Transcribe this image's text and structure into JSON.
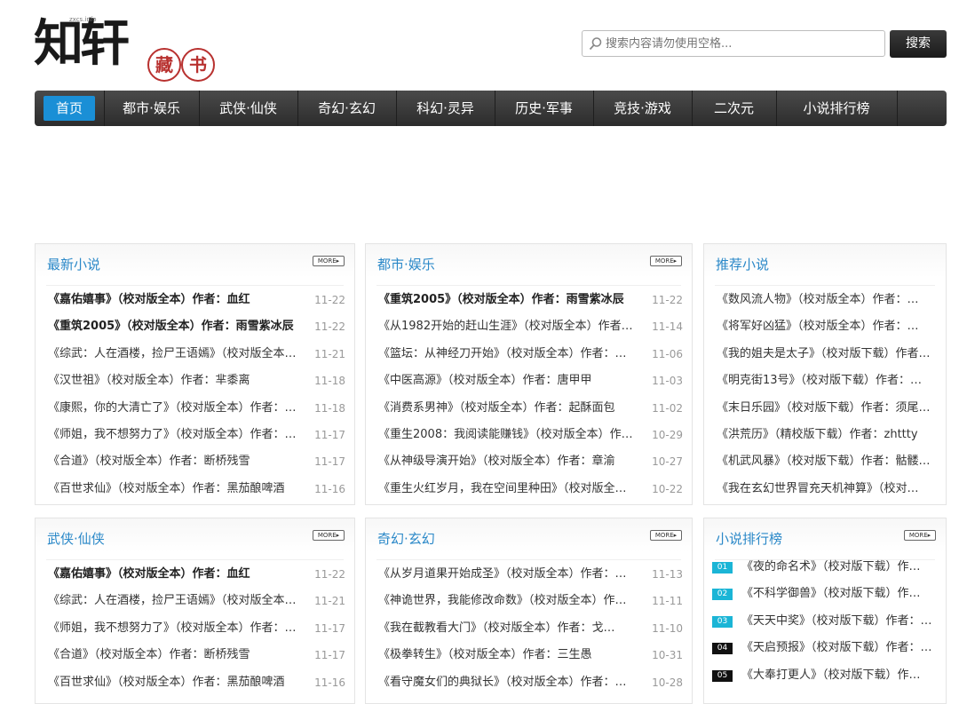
{
  "logo": {
    "main": "知轩",
    "small": "zxcs.info",
    "seal1": "藏",
    "seal2": "书"
  },
  "search": {
    "placeholder": "搜索内容请勿使用空格...",
    "button": "搜索"
  },
  "nav": [
    "首页",
    "都市·娱乐",
    "武侠·仙侠",
    "奇幻·玄幻",
    "科幻·灵异",
    "历史·军事",
    "竞技·游戏",
    "二次元",
    "小说排行榜"
  ],
  "more_label": "MORE▸",
  "panels": {
    "latest": {
      "title": "最新小说",
      "items": [
        {
          "text": "《嘉佑嬉事》（校对版全本）作者：血红",
          "date": "11-22"
        },
        {
          "text": "《重筑2005》（校对版全本）作者：雨雪紫冰辰",
          "date": "11-22"
        },
        {
          "text": "《综武：人在酒楼，捡尸王语嫣》（校对版全本）作者：…",
          "date": "11-21"
        },
        {
          "text": "《汉世祖》（校对版全本）作者：芈黍离",
          "date": "11-18"
        },
        {
          "text": "《康熙，你的大清亡了》（校对版全本）作者：…",
          "date": "11-18"
        },
        {
          "text": "《师姐，我不想努力了》（校对版全本）作者：…",
          "date": "11-17"
        },
        {
          "text": "《合道》（校对版全本）作者：断桥残雪",
          "date": "11-17"
        },
        {
          "text": "《百世求仙》（校对版全本）作者：黑茄酿啤酒",
          "date": "11-16"
        }
      ]
    },
    "urban": {
      "title": "都市·娱乐",
      "items": [
        {
          "text": "《重筑2005》（校对版全本）作者：雨雪紫冰辰",
          "date": "11-22"
        },
        {
          "text": "《从1982开始的赶山生涯》（校对版全本）作者：…",
          "date": "11-14"
        },
        {
          "text": "《篮坛：从神经刀开始》（校对版全本）作者：…",
          "date": "11-06"
        },
        {
          "text": "《中医高源》（校对版全本）作者：唐甲甲",
          "date": "11-03"
        },
        {
          "text": "《消费系男神》（校对版全本）作者：起酥面包",
          "date": "11-02"
        },
        {
          "text": "《重生2008：我阅读能赚钱》（校对版全本）作者：…",
          "date": "10-29"
        },
        {
          "text": "《从神级导演开始》（校对版全本）作者：章渝",
          "date": "10-27"
        },
        {
          "text": "《重生火红岁月，我在空间里种田》（校对版全本）作者：…",
          "date": "10-22"
        }
      ]
    },
    "recommend": {
      "title": "推荐小说",
      "items": [
        {
          "text": "《数风流人物》（校对版全本）作者：…"
        },
        {
          "text": "《将军好凶猛》（校对版全本）作者：…"
        },
        {
          "text": "《我的姐夫是太子》（校对版下载）作者：…"
        },
        {
          "text": "《明克街13号》（校对版下载）作者：…"
        },
        {
          "text": "《末日乐园》（校对版下载）作者：须尾…"
        },
        {
          "text": "《洪荒历》（精校版下载）作者：zhttty"
        },
        {
          "text": "《机武风暴》（校对版下载）作者：骷髅…"
        },
        {
          "text": "《我在玄幻世界冒充天机神算》（校对…"
        }
      ]
    },
    "wuxia": {
      "title": "武侠·仙侠",
      "items": [
        {
          "text": "《嘉佑嬉事》（校对版全本）作者：血红",
          "date": "11-22"
        },
        {
          "text": "《综武：人在酒楼，捡尸王语嫣》（校对版全本）作者：…",
          "date": "11-21"
        },
        {
          "text": "《师姐，我不想努力了》（校对版全本）作者：…",
          "date": "11-17"
        },
        {
          "text": "《合道》（校对版全本）作者：断桥残雪",
          "date": "11-17"
        },
        {
          "text": "《百世求仙》（校对版全本）作者：黑茄酿啤酒",
          "date": "11-16"
        }
      ]
    },
    "fantasy": {
      "title": "奇幻·玄幻",
      "items": [
        {
          "text": "《从岁月道果开始成圣》（校对版全本）作者：…",
          "date": "11-13"
        },
        {
          "text": "《神诡世界，我能修改命数》（校对版全本）作者：…",
          "date": "11-11"
        },
        {
          "text": "《我在截教看大门》（校对版全本）作者：戈…",
          "date": "11-10"
        },
        {
          "text": "《极拳转生》（校对版全本）作者：三生愚",
          "date": "10-31"
        },
        {
          "text": "《看守魔女们的典狱长》（校对版全本）作者：…",
          "date": "10-28"
        }
      ]
    },
    "ranking": {
      "title": "小说排行榜",
      "items": [
        {
          "rank": "01",
          "text": "《夜的命名术》（校对版下载）作…"
        },
        {
          "rank": "02",
          "text": "《不科学御兽》（校对版下载）作…"
        },
        {
          "rank": "03",
          "text": "《天天中奖》（校对版下载）作者：…"
        },
        {
          "rank": "04",
          "text": "《天启预报》（校对版下载）作者：…"
        },
        {
          "rank": "05",
          "text": "《大奉打更人》（校对版下载）作…"
        }
      ]
    }
  }
}
